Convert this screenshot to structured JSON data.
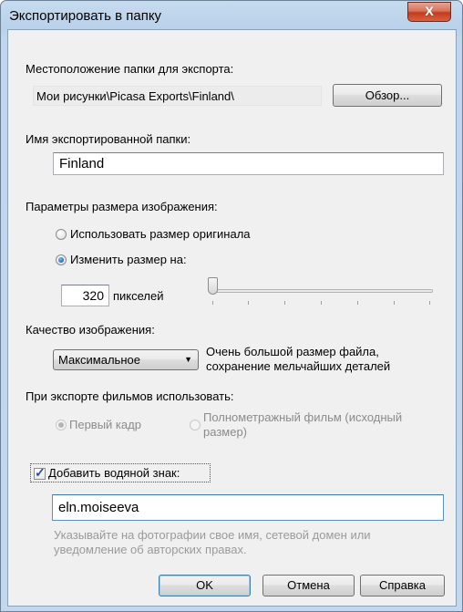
{
  "window": {
    "title": "Экспортировать в папку",
    "close_glyph": "X"
  },
  "location": {
    "label": "Местоположение папки для экспорта:",
    "path": "Мои рисунки\\Picasa Exports\\Finland\\",
    "browse_label": "Обзор..."
  },
  "folder_name": {
    "label": "Имя экспортированной папки:",
    "value": "Finland"
  },
  "size": {
    "label": "Параметры размера изображения:",
    "options": [
      {
        "label": "Использовать размер оригинала",
        "selected": false
      },
      {
        "label": "Изменить размер на:",
        "selected": true
      }
    ],
    "pixels_value": "320",
    "pixels_unit": "пикселей",
    "slider_level": 0.0
  },
  "quality": {
    "label": "Качество изображения:",
    "selected": "Максимальное",
    "description_line1": "Очень большой размер файла,",
    "description_line2": "сохранение мельчайших деталей"
  },
  "movies": {
    "label": "При экспорте фильмов использовать:",
    "option_first_frame": "Первый кадр",
    "option_full_line1": "Полнометражный фильм (исходный",
    "option_full_line2": "размер)",
    "selected": "first_frame"
  },
  "watermark": {
    "checkbox_label": "Добавить водяной знак:",
    "checked": true,
    "value": "eln.moiseeva",
    "hint_line1": "Указывайте на фотографии свое имя, сетевой домен или",
    "hint_line2": "уведомление об авторских правах."
  },
  "buttons": {
    "ok": "OK",
    "cancel": "Отмена",
    "help": "Справка"
  }
}
